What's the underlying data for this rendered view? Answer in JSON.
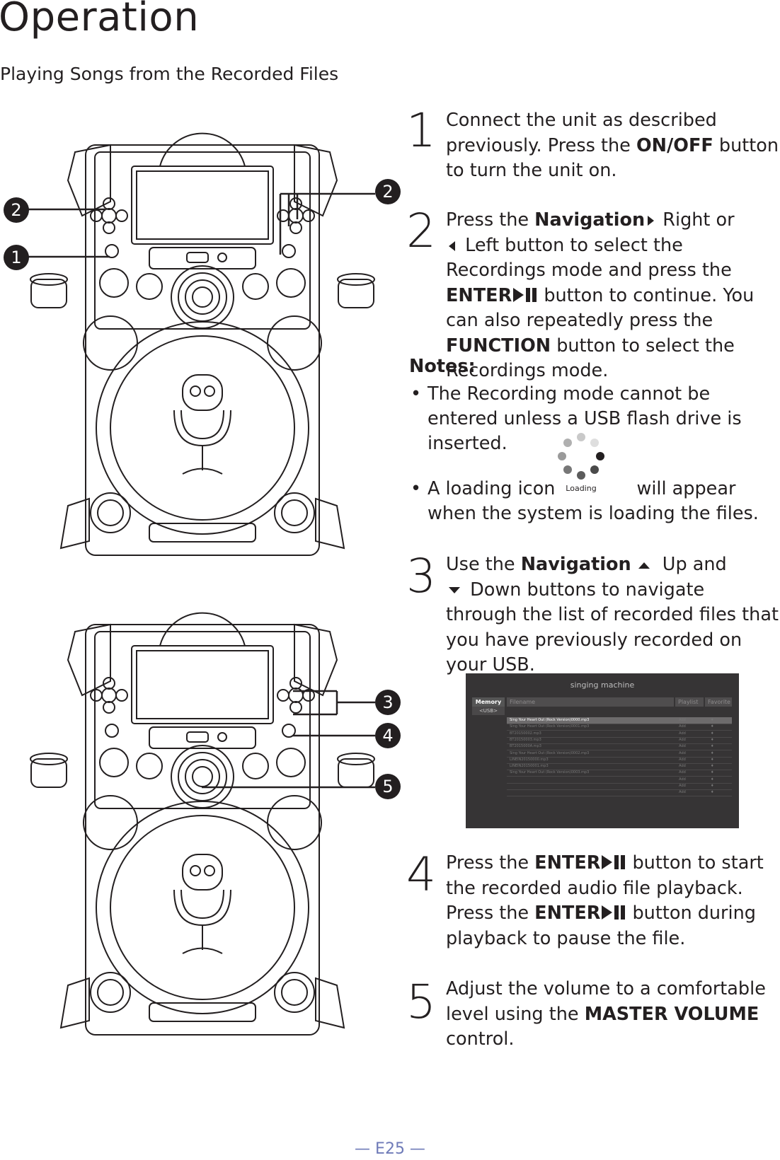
{
  "header": {
    "title": "Operation",
    "subtitle": "Playing Songs from the Recorded Files"
  },
  "callouts_top": [
    "2",
    "1",
    "2"
  ],
  "callouts_bottom": [
    "3",
    "4",
    "5"
  ],
  "steps": [
    {
      "num": "1",
      "t1": "Connect the unit as described previously. Press the ",
      "b1": "ON/OFF",
      "t2": " button to turn the unit on."
    },
    {
      "num": "2",
      "t1": "Press the ",
      "b1": "Navigation",
      "t2": " Right or",
      "t3": " Left button to select the Recordings mode and press the ",
      "b2": "ENTER",
      "t4": " button to continue. You can also repeatedly press the ",
      "b3": "FUNCTION",
      "t5": " button to select the Recordings mode."
    },
    {
      "num": "3",
      "t1": "Use the ",
      "b1": "Navigation",
      "t2": " Up and",
      "t3": " Down buttons to navigate through the list of recorded files that you have previously recorded on your USB."
    },
    {
      "num": "4",
      "t1": "Press the ",
      "b1": "ENTER",
      "t2": " button to start the recorded audio file playback. Press the ",
      "b2": "ENTER",
      "t3": " button during playback to pause the file."
    },
    {
      "num": "5",
      "t1": "Adjust the volume to a comfortable level using the ",
      "b1": "MASTER VOLUME",
      "t2": " control."
    }
  ],
  "notes": {
    "label": "Notes:",
    "bullet": "•",
    "items": [
      "The Recording mode cannot be entered unless a USB flash drive is inserted.",
      {
        "t1": "A loading icon",
        "t2": "will appear when the system is loading the files."
      }
    ],
    "loading_label": "Loading"
  },
  "screen": {
    "brand": "singing machine",
    "memory": "Memory",
    "usb": "<USB>",
    "columns": [
      "Filename",
      "Playlist",
      "Favorite"
    ],
    "rows": [
      {
        "file": "Sing Your Heart Out (Rock Version)0000.mp3",
        "playlist": "Add"
      },
      {
        "file": "Sing Your Heart Out (Rock Version)0001.mp3",
        "playlist": "Add"
      },
      {
        "file": "BT20150002.mp3",
        "playlist": "Add"
      },
      {
        "file": "BT20150003.mp3",
        "playlist": "Add"
      },
      {
        "file": "BT2015000A.mp3",
        "playlist": "Add"
      },
      {
        "file": "Sing Your Heart Out (Rock Version)0002.mp3",
        "playlist": "Add"
      },
      {
        "file": "LINEIN20150000.mp3",
        "playlist": "Add"
      },
      {
        "file": "LINEIN20150001.mp3",
        "playlist": "Add"
      },
      {
        "file": "Sing Your Heart Out (Rock Version)0003.mp3",
        "playlist": "Add"
      },
      {
        "file": "",
        "playlist": "Add"
      },
      {
        "file": "",
        "playlist": "Add"
      },
      {
        "file": "",
        "playlist": "Add"
      }
    ]
  },
  "footer": "— E25 —",
  "colors": {
    "text": "#231f20",
    "footer": "#6f7bb8",
    "screen_bg": "#363435"
  }
}
